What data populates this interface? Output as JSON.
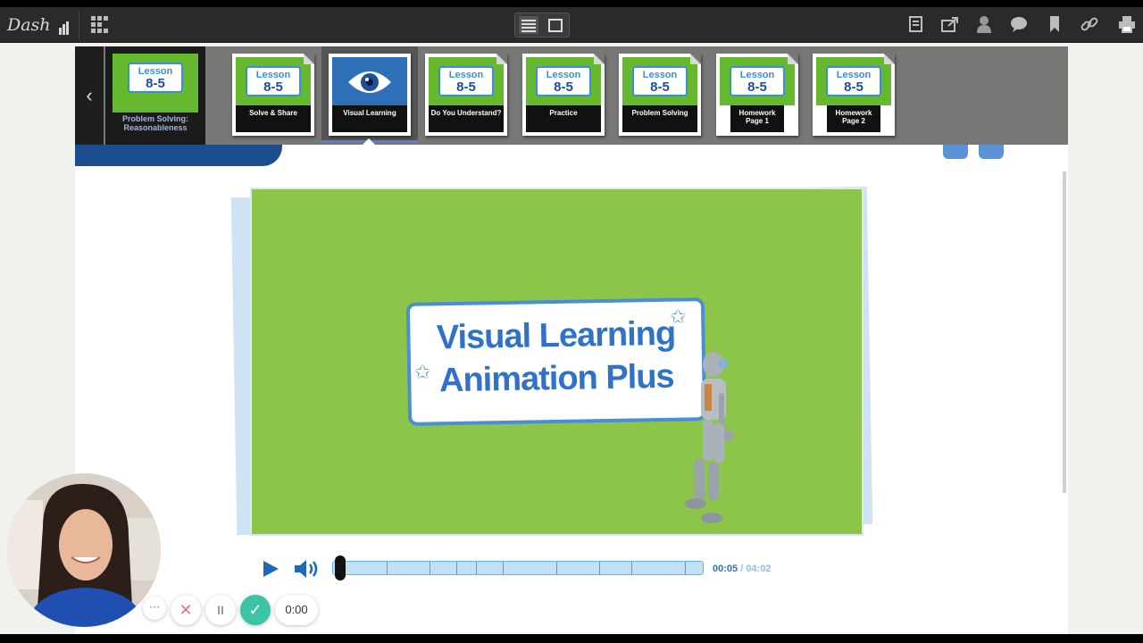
{
  "app": {
    "brand": "Dash"
  },
  "toolbar": {
    "icons": [
      "apps-grid-icon",
      "view-list-icon",
      "view-page-icon",
      "notes-icon",
      "share-icon",
      "user-icon",
      "chat-icon",
      "bookmark-icon",
      "link-icon",
      "print-icon"
    ]
  },
  "strip": {
    "current_lesson": {
      "badge_top": "Lesson",
      "badge_num": "8-5",
      "caption": "Problem Solving: Reasonableness"
    },
    "items": [
      {
        "badge_top": "Lesson",
        "badge_num": "8-5",
        "label": "Solve & Share"
      },
      {
        "label": "Visual Learning",
        "selected": true
      },
      {
        "badge_top": "Lesson",
        "badge_num": "8-5",
        "label": "Do You Understand?"
      },
      {
        "badge_top": "Lesson",
        "badge_num": "8-5",
        "label": "Practice"
      },
      {
        "badge_top": "Lesson",
        "badge_num": "8-5",
        "label": "Problem Solving"
      },
      {
        "badge_top": "Lesson",
        "badge_num": "8-5",
        "label": "Homework Page 1"
      },
      {
        "badge_top": "Lesson",
        "badge_num": "8-5",
        "label": "Homework Page 2"
      }
    ]
  },
  "video": {
    "title_line1": "Visual Learning",
    "title_line2": "Animation Plus",
    "current_time": "00:05",
    "separator": " / ",
    "total_time": "04:02",
    "progress": 0.02
  },
  "recorder": {
    "more": "···",
    "cancel": "✕",
    "pause": "II",
    "done": "✓",
    "elapsed": "0:00"
  },
  "colors": {
    "accent": "#2f72c8",
    "video_bg": "#8cc54a",
    "record_done": "#3cc4a6"
  }
}
